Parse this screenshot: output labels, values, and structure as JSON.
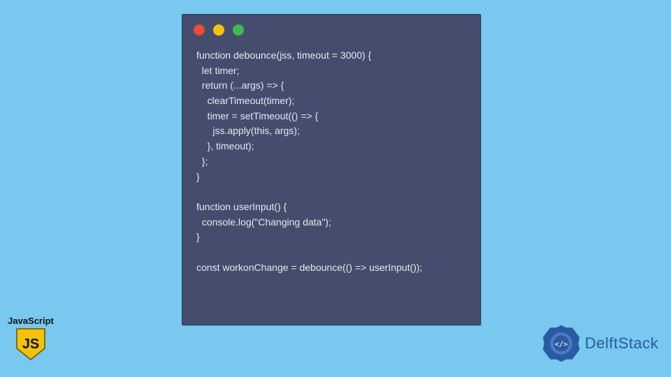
{
  "code": {
    "lines": [
      "function debounce(jss, timeout = 3000) {",
      "  let timer;",
      "  return (...args) => {",
      "    clearTimeout(timer);",
      "    timer = setTimeout(() => {",
      "      jss.apply(this, args);",
      "    }, timeout);",
      "  };",
      "}",
      "",
      "function userInput() {",
      "  console.log(\"Changing data\");",
      "}",
      "",
      "const workonChange = debounce(() => userInput());"
    ]
  },
  "js_badge": {
    "label": "JavaScript",
    "logo_letters": "JS"
  },
  "brand": {
    "name": "DelftStack",
    "inner_text": "</>"
  }
}
